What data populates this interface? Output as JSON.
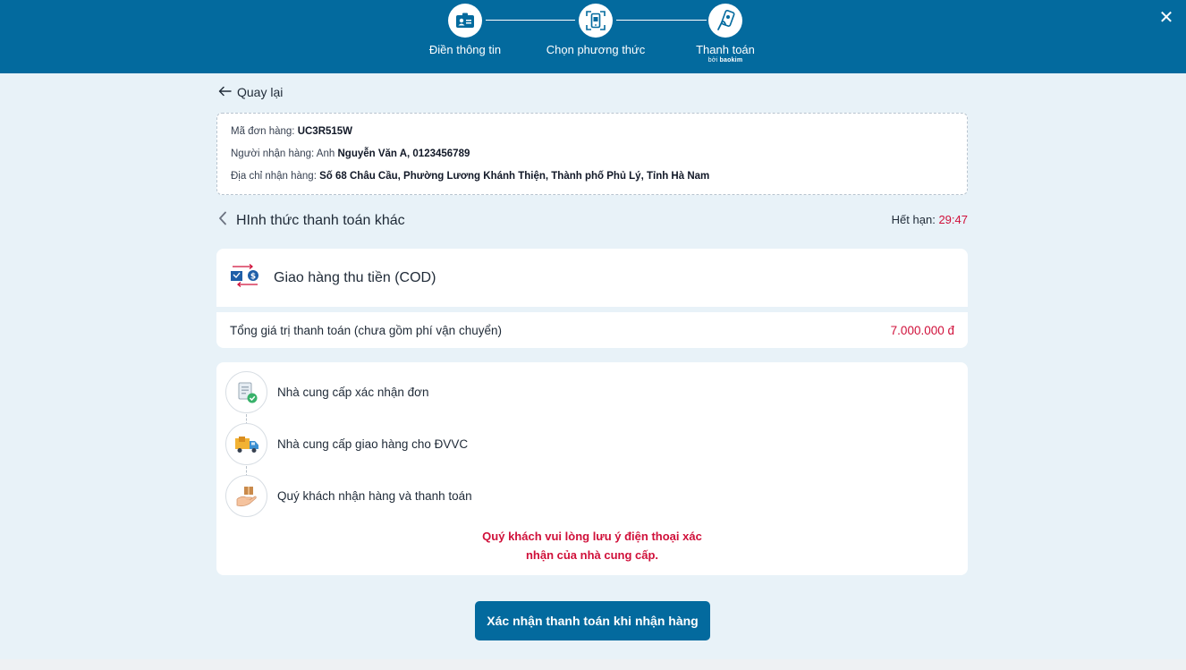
{
  "header": {
    "steps": [
      {
        "label": "Điền thông tin",
        "icon": "id-card-icon"
      },
      {
        "label": "Chọn phương thức",
        "icon": "phone-scan-icon"
      },
      {
        "label": "Thanh toán",
        "icon": "touch-payment-icon",
        "sub_prefix": "bởi",
        "sub_brand": "baokim"
      }
    ],
    "close_icon": "close-icon"
  },
  "back": {
    "label": "Quay lại"
  },
  "order": {
    "code_label": "Mã đơn hàng:",
    "code_value": "UC3R515W",
    "receiver_label": "Người nhận hàng: Anh",
    "receiver_value": "Nguyễn Văn A, 0123456789",
    "address_label": "Địa chỉ nhận hàng:",
    "address_value": "Số 68 Châu Cầu, Phường Lương Khánh Thiện, Thành phố Phủ Lý, Tỉnh Hà Nam"
  },
  "method": {
    "title": "HInh thức thanh toán khác",
    "deadline_label": "Hết hạn:",
    "deadline_value": "29:47"
  },
  "cod": {
    "label": "Giao hàng thu tiền (COD)",
    "total_label": "Tổng giá trị thanh toán (chưa gồm phí vận chuyển)",
    "total_value": "7.000.000 đ"
  },
  "process": {
    "steps": [
      {
        "label": "Nhà cung cấp xác nhận đơn",
        "icon": "order-confirm-icon"
      },
      {
        "label": "Nhà cung cấp giao hàng cho ĐVVC",
        "icon": "delivery-truck-icon"
      },
      {
        "label": "Quý khách nhận hàng và thanh toán",
        "icon": "hand-package-icon"
      }
    ],
    "notice_line1": "Quý khách vui lòng lưu ý điện thoại xác",
    "notice_line2": "nhận của nhà cung cấp."
  },
  "confirm_button": {
    "label": "Xác nhận thanh toán khi nhận hàng"
  },
  "colors": {
    "primary": "#036a9e",
    "accent_red": "#d0103a",
    "background": "#e8f2f8"
  }
}
